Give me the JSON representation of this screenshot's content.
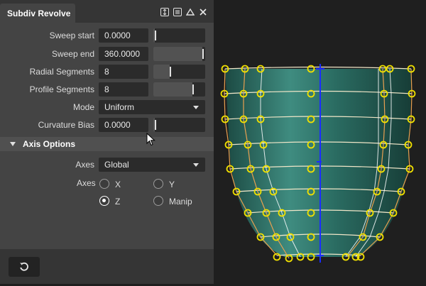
{
  "panel": {
    "tab_title": "Subdiv Revolve",
    "fields": [
      {
        "label": "Sweep start",
        "value": "0.0000",
        "slider": 0.02
      },
      {
        "label": "Sweep end",
        "value": "360.0000",
        "slider": 0.95
      },
      {
        "label": "Radial Segments",
        "value": "8",
        "slider": 0.32
      },
      {
        "label": "Profile Segments",
        "value": "8",
        "slider": 0.75
      }
    ],
    "mode": {
      "label": "Mode",
      "value": "Uniform"
    },
    "curvature": {
      "label": "Curvature Bias",
      "value": "0.0000",
      "slider": 0.02
    },
    "axis_section": "Axis Options",
    "axes_dropdown": {
      "label": "Axes",
      "value": "Global"
    },
    "axes_radio": {
      "label": "Axes",
      "options": [
        "X",
        "Y",
        "Z",
        "Manip"
      ],
      "selected": "Z"
    }
  },
  "icons": {
    "pin": "arrows-vertical-icon",
    "menu": "hamburger-menu-icon",
    "collapse": "triangle-up-icon",
    "close": "close-icon",
    "reset": "reset-icon"
  },
  "colors": {
    "accent_yellow": "#f0e000",
    "mesh_teal": "#2d6e64",
    "axis_blue": "#1a2cff",
    "curve_orange": "#e8a050"
  }
}
